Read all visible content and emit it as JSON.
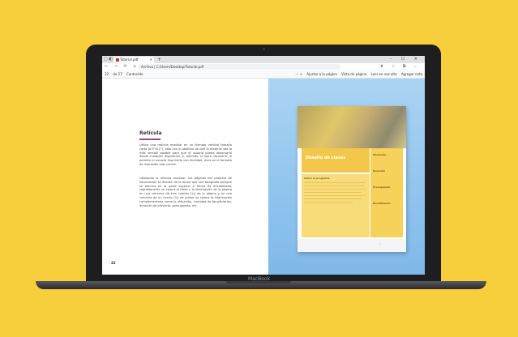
{
  "browser": {
    "tab_title": "Tutorial.pdf",
    "new_tab": "+",
    "window_controls": "– ☐ ✕",
    "titlebar_icons": "▢ ◧",
    "nav_buttons": "← → ⟳ ⌂",
    "url": "Archivo | C:/Users/Desktop/Tutorial.pdf",
    "addr_right": "★ ☆ ⧉ …"
  },
  "pdf_toolbar": {
    "page_box": "22",
    "page_total": "de 27",
    "contents": "Contenido",
    "zoom": "— +",
    "fit": "Ajustar a la página",
    "view": "Vista de página",
    "read_aloud": "Leer en voz alta",
    "add_note": "Agregar nota"
  },
  "page_left": {
    "heading": "Retícula",
    "para1": "Utiliza una retícula modular en un formato vertical tamaño carta (8.5\"x11\"), esto con el objetivo de que el material sea lo más versátil posible para que el usuario pueda observarlo desde cualquier dispositivo, y, además, si fuera necesario, le permite al usuario imprimirlo con facilidad, pues es el formato de impresión más común.",
    "para2": "Utilizando la retícula modular, las páginas del paquete de información se dividen de la forma que una fotografía siempre se ubicará en la parte superior a forma de encabezado, seguidamente se coloca el título y la descripción de la página en una columna de tres cuartos (¾) de la página y en una columna de un cuarto (¼) de grosor se coloca la información complementaria como lo ubicación, cantidad de beneficiarios, duración de proyecto, presupuesto, etc.",
    "page_number": "22"
  },
  "mockup": {
    "banner_title": "Desafío de clases",
    "text_title": "Sobre el programa",
    "sidebar_items": [
      "Ubicación",
      "Duración",
      "Presupuesto",
      "Beneficiarios"
    ],
    "tap_icon": "☝"
  },
  "laptop": {
    "brand": "MacBook"
  }
}
